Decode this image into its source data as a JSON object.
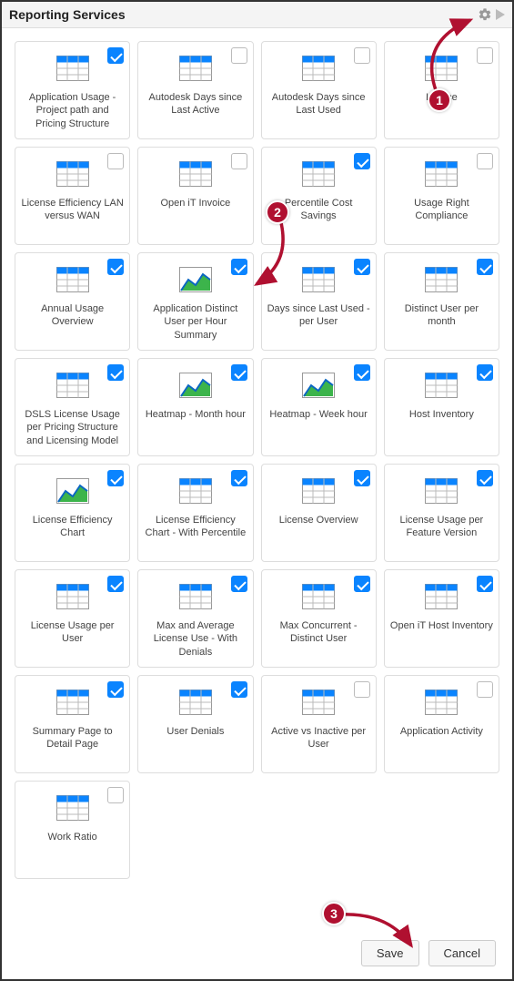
{
  "header": {
    "title": "Reporting Services"
  },
  "tiles": [
    {
      "label": "Application Usage - Project path and Pricing Structure",
      "checked": true,
      "icon": "table"
    },
    {
      "label": "Autodesk Days since Last Active",
      "checked": false,
      "icon": "table"
    },
    {
      "label": "Autodesk Days since Last Used",
      "checked": false,
      "icon": "table"
    },
    {
      "label": "Invoice",
      "checked": false,
      "icon": "table"
    },
    {
      "label": "License Efficiency LAN versus WAN",
      "checked": false,
      "icon": "table"
    },
    {
      "label": "Open iT Invoice",
      "checked": false,
      "icon": "table"
    },
    {
      "label": "Percentile Cost Savings",
      "checked": true,
      "icon": "table"
    },
    {
      "label": "Usage Right Compliance",
      "checked": false,
      "icon": "table"
    },
    {
      "label": "Annual Usage Overview",
      "checked": true,
      "icon": "table"
    },
    {
      "label": "Application Distinct User per Hour Summary",
      "checked": true,
      "icon": "chart"
    },
    {
      "label": "Days since Last Used - per User",
      "checked": true,
      "icon": "table"
    },
    {
      "label": "Distinct User per month",
      "checked": true,
      "icon": "table"
    },
    {
      "label": "DSLS License Usage per Pricing Structure and Licensing Model",
      "checked": true,
      "icon": "table"
    },
    {
      "label": "Heatmap - Month hour",
      "checked": true,
      "icon": "chart"
    },
    {
      "label": "Heatmap - Week hour",
      "checked": true,
      "icon": "chart"
    },
    {
      "label": "Host Inventory",
      "checked": true,
      "icon": "table"
    },
    {
      "label": "License Efficiency Chart",
      "checked": true,
      "icon": "chart"
    },
    {
      "label": "License Efficiency Chart - With Percentile",
      "checked": true,
      "icon": "table"
    },
    {
      "label": "License Overview",
      "checked": true,
      "icon": "table"
    },
    {
      "label": "License Usage per Feature Version",
      "checked": true,
      "icon": "table"
    },
    {
      "label": "License Usage per User",
      "checked": true,
      "icon": "table"
    },
    {
      "label": "Max and Average License Use - With Denials",
      "checked": true,
      "icon": "table"
    },
    {
      "label": "Max Concurrent - Distinct User",
      "checked": true,
      "icon": "table"
    },
    {
      "label": "Open iT Host Inventory",
      "checked": true,
      "icon": "table"
    },
    {
      "label": "Summary Page to Detail Page",
      "checked": true,
      "icon": "table"
    },
    {
      "label": "User Denials",
      "checked": true,
      "icon": "table"
    },
    {
      "label": "Active vs Inactive per User",
      "checked": false,
      "icon": "table"
    },
    {
      "label": "Application Activity",
      "checked": false,
      "icon": "table"
    },
    {
      "label": "Work Ratio",
      "checked": false,
      "icon": "table"
    }
  ],
  "footer": {
    "save_label": "Save",
    "cancel_label": "Cancel"
  },
  "annotations": {
    "b1": "1",
    "b2": "2",
    "b3": "3"
  }
}
